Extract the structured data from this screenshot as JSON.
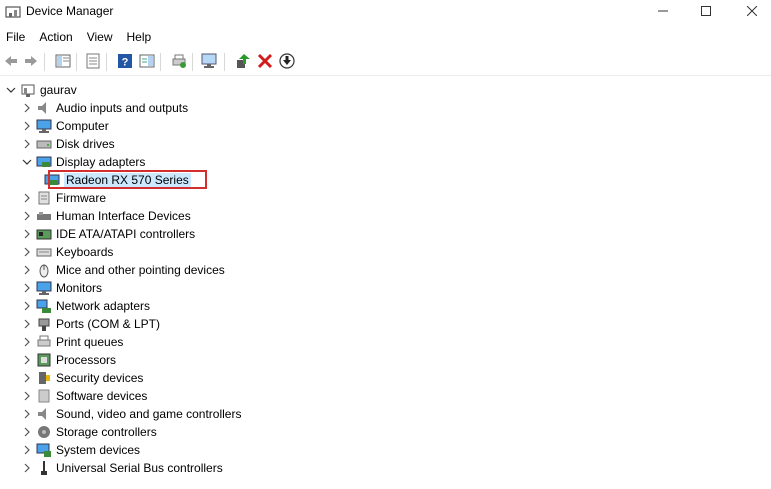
{
  "window": {
    "title": "Device Manager",
    "controls": [
      "minimize-icon",
      "maximize-icon",
      "close-icon"
    ]
  },
  "menu": [
    "File",
    "Action",
    "View",
    "Help"
  ],
  "toolbar": [
    "back-arrow-icon",
    "forward-arrow-icon",
    "show-hide-tree-icon",
    "properties-icon",
    "help-icon",
    "action-pane-icon",
    "print-icon",
    "scan-hardware-icon",
    "update-driver-icon",
    "uninstall-icon",
    "disable-device-icon"
  ],
  "tree": {
    "root": "gaurav",
    "items": [
      {
        "label": "Audio inputs and outputs",
        "icon": "speaker-icon"
      },
      {
        "label": "Computer",
        "icon": "computer-icon"
      },
      {
        "label": "Disk drives",
        "icon": "disk-drive-icon"
      },
      {
        "label": "Display adapters",
        "icon": "display-adapter-icon",
        "expanded": true
      },
      {
        "label": "Radeon RX 570 Series",
        "icon": "gpu-icon",
        "child": true,
        "selected": true
      },
      {
        "label": "Firmware",
        "icon": "firmware-icon"
      },
      {
        "label": "Human Interface Devices",
        "icon": "hid-icon"
      },
      {
        "label": "IDE ATA/ATAPI controllers",
        "icon": "ide-controller-icon"
      },
      {
        "label": "Keyboards",
        "icon": "keyboard-icon"
      },
      {
        "label": "Mice and other pointing devices",
        "icon": "mouse-icon"
      },
      {
        "label": "Monitors",
        "icon": "monitor-icon"
      },
      {
        "label": "Network adapters",
        "icon": "network-adapter-icon"
      },
      {
        "label": "Ports (COM & LPT)",
        "icon": "port-icon"
      },
      {
        "label": "Print queues",
        "icon": "printer-icon"
      },
      {
        "label": "Processors",
        "icon": "processor-icon"
      },
      {
        "label": "Security devices",
        "icon": "security-device-icon"
      },
      {
        "label": "Software devices",
        "icon": "software-device-icon"
      },
      {
        "label": "Sound, video and game controllers",
        "icon": "sound-controller-icon"
      },
      {
        "label": "Storage controllers",
        "icon": "storage-controller-icon"
      },
      {
        "label": "System devices",
        "icon": "system-device-icon"
      },
      {
        "label": "Universal Serial Bus controllers",
        "icon": "usb-icon"
      }
    ]
  },
  "colors": {
    "highlight_border": "#d32f2f",
    "selection": "#cce8ff",
    "accent": "#1a6fb5"
  }
}
